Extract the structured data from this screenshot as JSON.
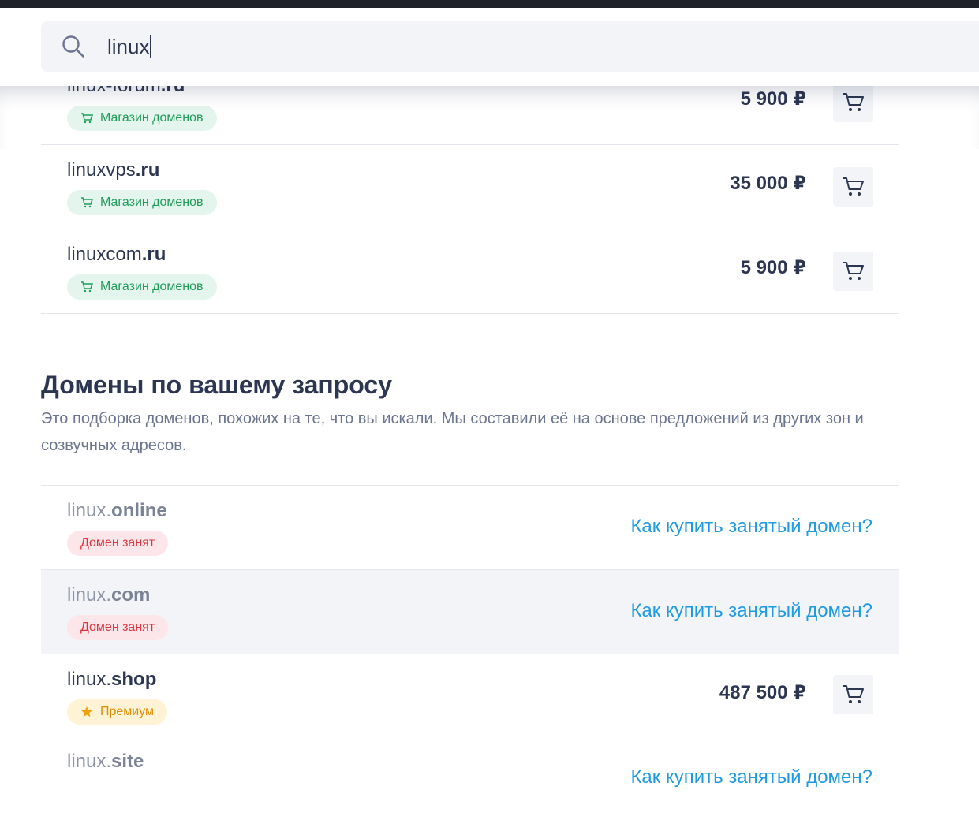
{
  "search": {
    "query": "linux"
  },
  "top_list": [
    {
      "name": "linux-forum",
      "zone": ".ru",
      "badge": "Магазин доменов",
      "price": "5 900 ₽"
    },
    {
      "name": "linuxvps",
      "zone": ".ru",
      "badge": "Магазин доменов",
      "price": "35 000 ₽"
    },
    {
      "name": "linuxcom",
      "zone": ".ru",
      "badge": "Магазин доменов",
      "price": "5 900 ₽"
    }
  ],
  "section": {
    "title": "Домены по вашему запросу",
    "description": "Это подборка доменов, похожих на те, что вы искали. Мы составили её на основе предложений из других зон и созвучных адресов."
  },
  "results": [
    {
      "name": "linux.",
      "zone": "online",
      "badge": "Домен занят",
      "link": "Как купить занятый домен?"
    },
    {
      "name": "linux.",
      "zone": "com",
      "badge": "Домен занят",
      "link": "Как купить занятый домен?"
    },
    {
      "name": "linux.",
      "zone": "shop",
      "badge": "Премиум",
      "price": "487 500 ₽"
    },
    {
      "name": "linux.",
      "zone": "site",
      "link": "Как купить занятый домен?"
    }
  ],
  "colors": {
    "text": "#2c3651",
    "link": "#1f9be3",
    "shop_badge": "#1f9b5a",
    "taken_badge": "#e0333f",
    "premium_badge": "#e38d00"
  }
}
